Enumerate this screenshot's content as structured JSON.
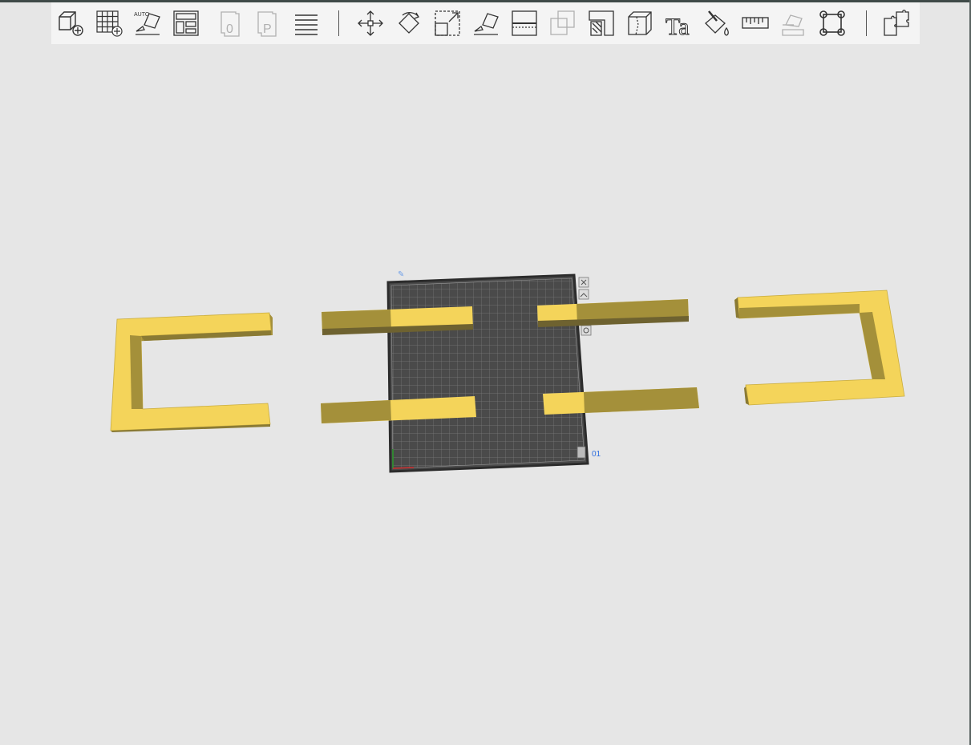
{
  "toolbar": {
    "items": [
      {
        "name": "add-object-button",
        "icon": "cube-plus-icon",
        "disabled": false
      },
      {
        "name": "add-plate-button",
        "icon": "grid-plus-icon",
        "disabled": false
      },
      {
        "name": "auto-orient-button",
        "icon": "auto-orient-icon",
        "label": "AUTO",
        "disabled": false
      },
      {
        "name": "arrange-button",
        "icon": "arrange-layout-icon",
        "disabled": false
      },
      {
        "name": "plate-0-button",
        "icon": "plate-zero-icon",
        "label": "0",
        "disabled": true
      },
      {
        "name": "plate-p-button",
        "icon": "plate-p-icon",
        "label": "P",
        "disabled": true
      },
      {
        "name": "layers-button",
        "icon": "layers-icon",
        "disabled": false
      },
      {
        "name": "move-button",
        "icon": "move-arrows-icon",
        "disabled": false
      },
      {
        "name": "rotate-button",
        "icon": "rotate-icon",
        "disabled": false
      },
      {
        "name": "scale-button",
        "icon": "scale-icon",
        "disabled": false
      },
      {
        "name": "lay-on-face-button",
        "icon": "lay-on-face-icon",
        "disabled": false
      },
      {
        "name": "cut-button",
        "icon": "cut-icon",
        "disabled": false
      },
      {
        "name": "boolean-button",
        "icon": "boolean-icon",
        "disabled": true
      },
      {
        "name": "support-paint-button",
        "icon": "support-paint-icon",
        "disabled": false
      },
      {
        "name": "seam-paint-button",
        "icon": "seam-paint-icon",
        "disabled": false
      },
      {
        "name": "text-button",
        "icon": "text-tool-icon",
        "label": "Ta",
        "disabled": false
      },
      {
        "name": "color-paint-button",
        "icon": "paint-bucket-icon",
        "disabled": false
      },
      {
        "name": "measure-button",
        "icon": "ruler-icon",
        "disabled": false
      },
      {
        "name": "assembly-button",
        "icon": "assembly-icon",
        "disabled": true
      },
      {
        "name": "brim-ears-button",
        "icon": "brim-ears-icon",
        "disabled": false
      },
      {
        "name": "split-parts-button",
        "icon": "puzzle-icon",
        "disabled": false
      }
    ]
  },
  "plate": {
    "number_label": "01",
    "icons": [
      "close-icon",
      "image-icon",
      "settings-icon",
      "lock-icon"
    ]
  },
  "colors": {
    "model_top": "#f4d45a",
    "model_side": "#a4903a",
    "plate": "#4a4a4a",
    "background": "#e6e6e6",
    "accent": "#2f6fe0"
  }
}
